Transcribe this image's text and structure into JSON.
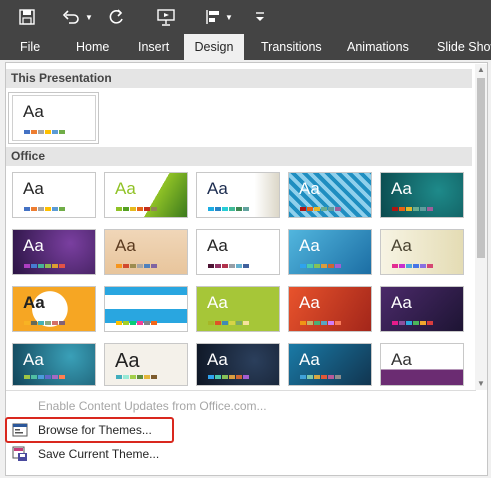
{
  "ribbon": {
    "tabs": [
      "File",
      "Home",
      "Insert",
      "Design",
      "Transitions",
      "Animations",
      "Slide Show"
    ],
    "active_tab": "Design",
    "background": "#444444"
  },
  "gallery": {
    "section_this_presentation": "This Presentation",
    "section_office": "Office",
    "sample_text": "Aa"
  },
  "menu": {
    "enable_updates": "Enable Content Updates from Office.com...",
    "browse_themes": "Browse for Themes...",
    "save_theme": "Save Current Theme..."
  },
  "highlight_color": "#d9281e"
}
